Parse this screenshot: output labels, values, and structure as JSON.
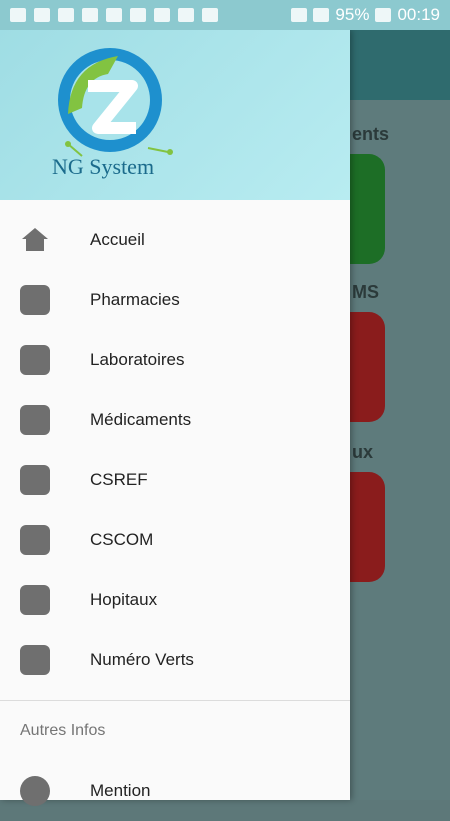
{
  "status_bar": {
    "battery": "95%",
    "time": "00:19"
  },
  "header": {
    "logo_text": "NG System"
  },
  "menu": {
    "items": [
      {
        "label": "Accueil",
        "icon": "home-icon"
      },
      {
        "label": "Pharmacies",
        "icon": "square-icon"
      },
      {
        "label": "Laboratoires",
        "icon": "square-icon"
      },
      {
        "label": "Médicaments",
        "icon": "square-icon"
      },
      {
        "label": "CSREF",
        "icon": "square-icon"
      },
      {
        "label": "CSCOM",
        "icon": "square-icon"
      },
      {
        "label": "Hopitaux",
        "icon": "square-icon"
      },
      {
        "label": "Numéro Verts",
        "icon": "square-icon"
      }
    ],
    "section_title": "Autres Infos",
    "other_items": [
      {
        "label": "Mention",
        "icon": "circle-icon"
      }
    ]
  },
  "background": {
    "labels": [
      "ents",
      "MS",
      "ux"
    ]
  }
}
